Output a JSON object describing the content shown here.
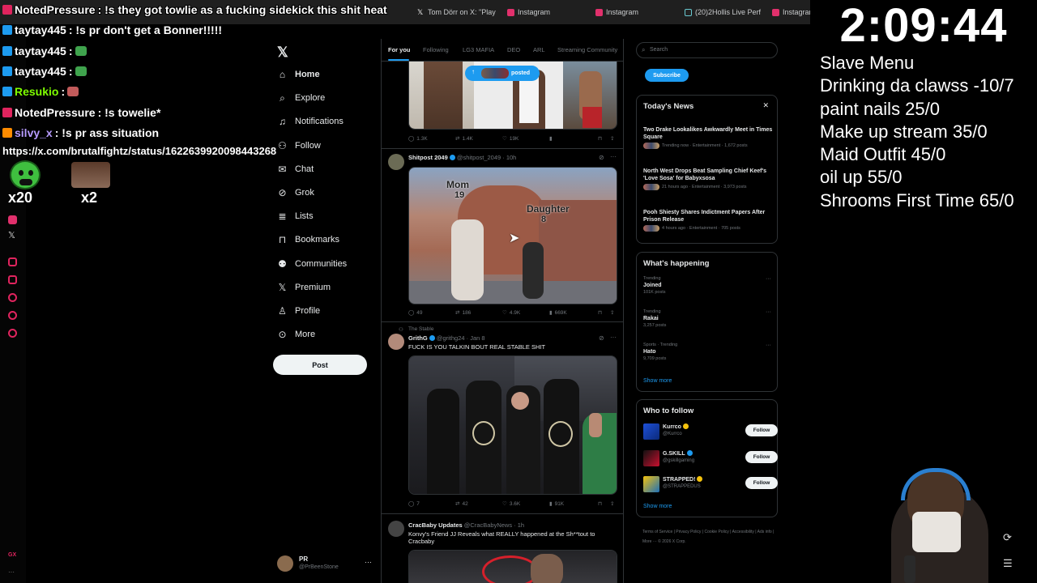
{
  "browser": {
    "tabs": [
      {
        "label": "Tom Dörr on X: \"Play",
        "icon": "x-icon",
        "color": "#ffffff"
      },
      {
        "label": "Instagram",
        "icon": "instagram-icon",
        "color": "#e1306c"
      },
      {
        "label": "Instagram",
        "icon": "instagram-icon",
        "color": "#e1306c"
      },
      {
        "label": "(20)2Hollis Live Perf",
        "icon": "tiktok-icon",
        "color": "#ffffff"
      },
      {
        "label": "Instagram",
        "icon": "instagram-icon",
        "color": "#e1306c"
      }
    ]
  },
  "nav": {
    "items": [
      {
        "label": "Home",
        "icon": "home-icon"
      },
      {
        "label": "Explore",
        "icon": "search-icon"
      },
      {
        "label": "Notifications",
        "icon": "bell-icon"
      },
      {
        "label": "Follow",
        "icon": "follow-icon"
      },
      {
        "label": "Chat",
        "icon": "mail-icon"
      },
      {
        "label": "Grok",
        "icon": "grok-icon"
      },
      {
        "label": "Lists",
        "icon": "list-icon"
      },
      {
        "label": "Bookmarks",
        "icon": "bookmark-icon"
      },
      {
        "label": "Communities",
        "icon": "people-icon"
      },
      {
        "label": "Premium",
        "icon": "x-icon"
      },
      {
        "label": "Profile",
        "icon": "person-icon"
      },
      {
        "label": "More",
        "icon": "more-circle-icon"
      }
    ],
    "post_label": "Post",
    "account": {
      "name": "PR",
      "handle": "@PrBeenStone"
    }
  },
  "feed": {
    "tabs": [
      "For you",
      "Following",
      "LG3 MAFIA",
      "DEO",
      "ARL",
      "Streaming Community"
    ],
    "posted_pill": "posted",
    "tweets": [
      {
        "actions": {
          "replies": "1.3K",
          "reposts": "1.4K",
          "likes": "19K",
          "views": ""
        }
      },
      {
        "name": "Shitpost 2049",
        "handle": "@shitpost_2049 · 10h",
        "media_text_1": "Mom",
        "media_text_2": "19",
        "media_text_3": "Daughter",
        "media_text_4": "8",
        "actions": {
          "replies": "49",
          "reposts": "186",
          "likes": "4.9K",
          "views": "669K"
        }
      },
      {
        "context": "The Stable",
        "name": "GrithG",
        "handle": "@grithg24 · Jan 8",
        "text": "FUCK IS YOU TALKIN BOUT REAL STABLE SHIT",
        "actions": {
          "replies": "7",
          "reposts": "42",
          "likes": "3.6K",
          "views": "91K"
        }
      },
      {
        "name": "CracBaby Updates",
        "handle": "@CracBabyNews · 1h",
        "text": "Konvy's Friend JJ Reveals what REALLY happened at the Sh**tout to Cracbaby"
      }
    ]
  },
  "sidebar": {
    "search_placeholder": "Search",
    "subscribe_label": "Subscribe",
    "news": {
      "title": "Today's News",
      "items": [
        {
          "title": "Two Drake Lookalikes Awkwardly Meet in Times Square",
          "meta": "Trending now · Entertainment · 1,672 posts"
        },
        {
          "title": "North West Drops Beat Sampling Chief Keef's 'Love Sosa' for Babyxsosa",
          "meta": "21 hours ago · Entertainment · 3,973 posts"
        },
        {
          "title": "Pooh Shiesty Shares Indictment Papers After Prison Release",
          "meta": "4 hours ago · Entertainment · 705 posts"
        }
      ]
    },
    "happening": {
      "title": "What's happening",
      "items": [
        {
          "category": "Trending",
          "topic": "Joined",
          "posts": "101K posts"
        },
        {
          "category": "Trending",
          "topic": "Rakai",
          "posts": "3,257 posts"
        },
        {
          "category": "Sports · Trending",
          "topic": "Hato",
          "posts": "9,709 posts"
        }
      ],
      "show_more": "Show more"
    },
    "who_to_follow": {
      "title": "Who to follow",
      "items": [
        {
          "name": "Kurrco",
          "handle": "@Kurrco",
          "button": "Follow",
          "badge_color": "#f4c20d"
        },
        {
          "name": "G.SKILL",
          "handle": "@gskillgaming",
          "button": "Follow",
          "badge_color": "#1d9bf0"
        },
        {
          "name": "STRAPPED!",
          "handle": "@STRAPPEDUS",
          "button": "Follow",
          "badge_color": "#f4c20d"
        }
      ],
      "show_more": "Show more"
    },
    "footer": "Terms of Service | Privacy Policy | Cookie Policy | Accessibility | Ads info | More ··· © 2026 X Corp."
  },
  "stream": {
    "chat": [
      {
        "user": "NotedPressure",
        "user_color": "#ffffff",
        "text": ": !s they got towlie as a fucking sidekick this shit heat"
      },
      {
        "user": "taytay445",
        "user_color": "#ffffff",
        "text": ": !s pr don't get a Bonner!!!!!"
      },
      {
        "user": "taytay445",
        "user_color": "#ffffff",
        "text": ":"
      },
      {
        "user": "taytay445",
        "user_color": "#ffffff",
        "text": ":"
      },
      {
        "user": "Resukio",
        "user_color": "#7fff00",
        "text": ":"
      },
      {
        "user": "NotedPressure",
        "user_color": "#ffffff",
        "text": ": !s towelie*"
      },
      {
        "user": "silvy_x",
        "user_color": "#b79bff",
        "text": ": !s pr ass situation"
      }
    ],
    "link_line": "https://x.com/brutalfightz/status/1622639920098443268",
    "emote_counts": [
      "x20",
      "x2"
    ],
    "timer": "2:09:44",
    "menu": [
      "Slave Menu",
      "Drinking da clawss -10/7",
      "paint nails 25/0",
      "Make up stream 35/0",
      "Maid Outfit 45/0",
      "oil up 55/0",
      "Shrooms First Time 65/0"
    ]
  }
}
